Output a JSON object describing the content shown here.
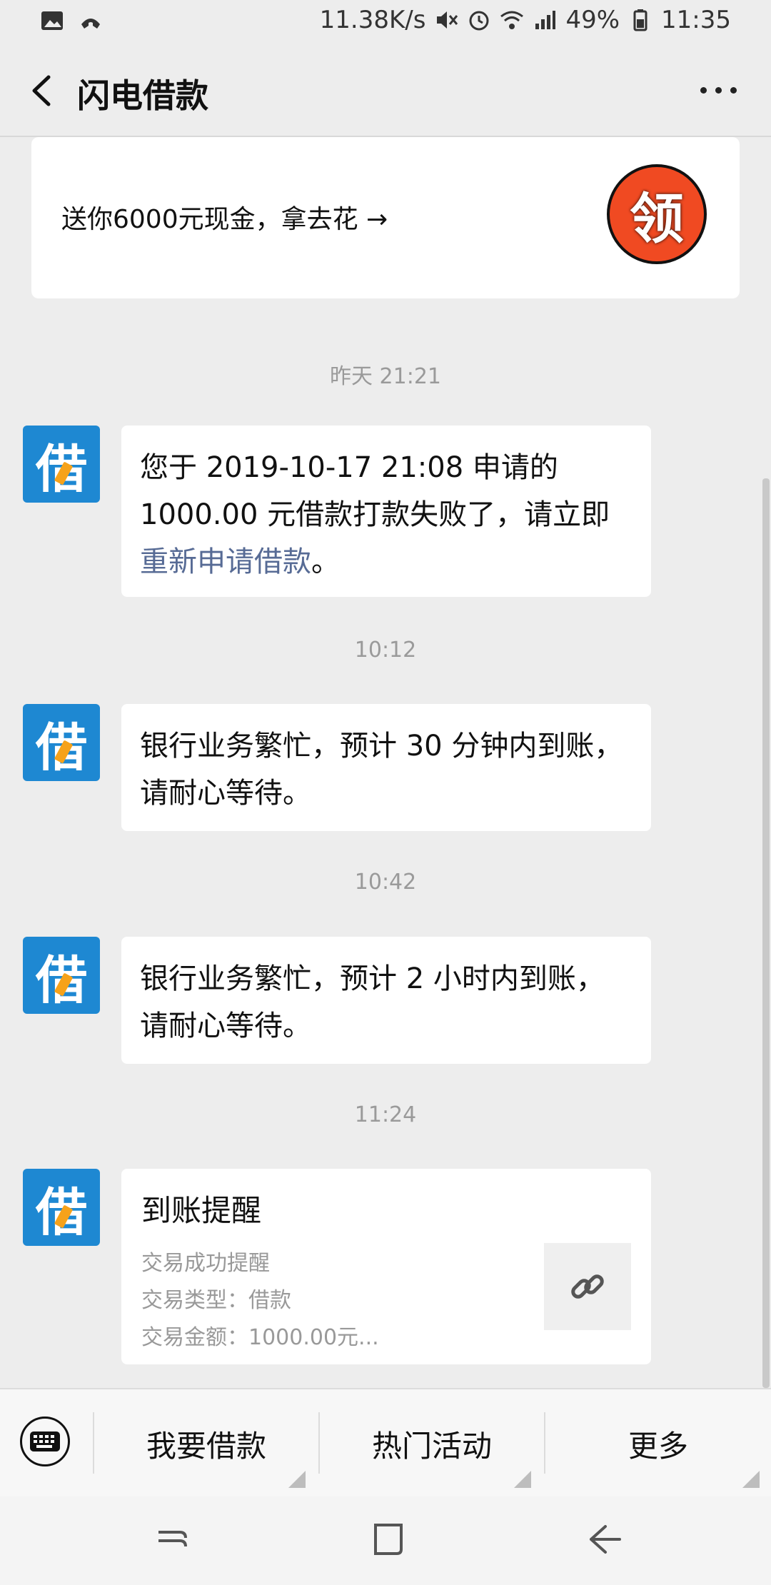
{
  "status_bar": {
    "speed": "11.38K/s",
    "battery": "49%",
    "time": "11:35",
    "icons": [
      "image-icon",
      "call-icon",
      "mute-icon",
      "alarm-icon",
      "wifi-icon",
      "signal-icon",
      "battery-icon"
    ]
  },
  "nav": {
    "title": "闪电借款",
    "back_icon": "chevron-left-icon",
    "more_icon": "more-dots-icon"
  },
  "promo": {
    "text": "送你6000元现金，拿去花 →",
    "badge": "领"
  },
  "messages": [
    {
      "time": "昨天 21:21",
      "avatar": "借",
      "text_before": "您于 2019-10-17 21:08 申请的 1000.00 元借款打款失败了，请立即",
      "link": "重新申请借款",
      "text_after": "。"
    },
    {
      "time": "10:12",
      "avatar": "借",
      "text": "银行业务繁忙，预计 30 分钟内到账，请耐心等待。"
    },
    {
      "time": "10:42",
      "avatar": "借",
      "text": "银行业务繁忙，预计 2 小时内到账，请耐心等待。"
    },
    {
      "time": "11:24",
      "avatar": "借",
      "card": {
        "title": "到账提醒",
        "line1": "交易成功提醒",
        "line2": "交易类型：借款",
        "line3": "交易金额：1000.00元...",
        "thumb_icon": "link-icon"
      }
    }
  ],
  "bottom_menu": {
    "keyboard_icon": "keyboard-icon",
    "items": [
      "我要借款",
      "热门活动",
      "更多"
    ]
  },
  "system_nav": {
    "icons": [
      "recent-apps-icon",
      "home-icon",
      "back-icon"
    ]
  }
}
